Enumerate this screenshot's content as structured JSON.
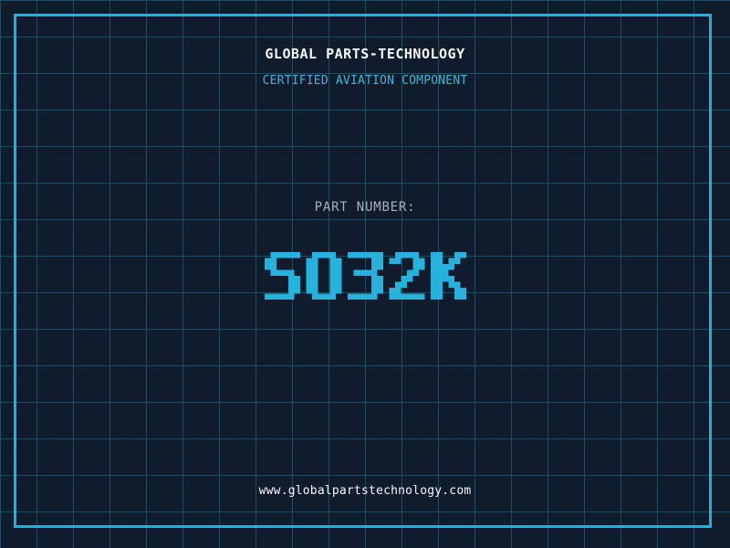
{
  "colors": {
    "background": "#101b2b",
    "grid_line": "#1d4d63",
    "frame": "#15b5e2",
    "accent_cyan": "#27b2dd",
    "subtitle_cyan": "#3cb6d8",
    "label_gray": "#a9b2ba",
    "text_white": "#f5f9fb"
  },
  "header": {
    "company": "GLOBAL PARTS-TECHNOLOGY",
    "subtitle": "CERTIFIED AVIATION COMPONENT"
  },
  "part": {
    "label": "PART NUMBER:",
    "value": "SO32K"
  },
  "footer": {
    "website": "www.globalpartstechnology.com"
  }
}
